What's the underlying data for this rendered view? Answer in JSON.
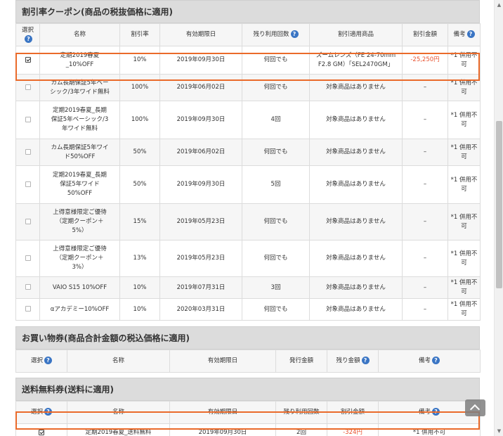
{
  "discount_section": {
    "title": "割引率クーポン(商品の税抜価格に適用)",
    "headers": {
      "select": "選択",
      "name": "名称",
      "rate": "割引率",
      "expiry": "有効期限日",
      "remaining": "残り利用回数",
      "product": "割引適用商品",
      "amount": "割引金額",
      "note": "備考"
    },
    "rows": [
      {
        "checked": true,
        "name": "定期2019春夏\n_10%OFF",
        "rate": "10%",
        "expiry": "2019年09月30日",
        "remaining": "何回でも",
        "product": "ズームレンズ（FE 24-70mm\nF2.8 GM）「SEL2470GM」",
        "amount": "-25,250円",
        "note": "*1 併用不可"
      },
      {
        "checked": false,
        "name": "カム長期保証5年ベー\nシック/3年ワイド無料",
        "rate": "100%",
        "expiry": "2019年06月02日",
        "remaining": "何回でも",
        "product": "対象商品はありません",
        "amount": "–",
        "note": "*1 併用不可"
      },
      {
        "checked": false,
        "name": "定期2019春夏_長期\n保証5年ベーシック/3\n年ワイド無料",
        "rate": "100%",
        "expiry": "2019年09月30日",
        "remaining": "4回",
        "product": "対象商品はありません",
        "amount": "–",
        "note": "*1 併用不可"
      },
      {
        "checked": false,
        "name": "カム長期保証5年ワイ\nド50%OFF",
        "rate": "50%",
        "expiry": "2019年06月02日",
        "remaining": "何回でも",
        "product": "対象商品はありません",
        "amount": "–",
        "note": "*1 併用不可"
      },
      {
        "checked": false,
        "name": "定期2019春夏_長期\n保証5年ワイド\n50%OFF",
        "rate": "50%",
        "expiry": "2019年09月30日",
        "remaining": "5回",
        "product": "対象商品はありません",
        "amount": "–",
        "note": "*1 併用不可"
      },
      {
        "checked": false,
        "name": "上得意様限定ご優待\n（定期クーポン＋\n5%）",
        "rate": "15%",
        "expiry": "2019年05月23日",
        "remaining": "何回でも",
        "product": "対象商品はありません",
        "amount": "–",
        "note": "*1 併用不可"
      },
      {
        "checked": false,
        "name": "上得意様限定ご優待\n（定期クーポン＋\n3%）",
        "rate": "13%",
        "expiry": "2019年05月23日",
        "remaining": "何回でも",
        "product": "対象商品はありません",
        "amount": "–",
        "note": "*1 併用不可"
      },
      {
        "checked": false,
        "name": "VAIO S15 10%OFF",
        "rate": "10%",
        "expiry": "2019年07月31日",
        "remaining": "3回",
        "product": "対象商品はありません",
        "amount": "–",
        "note": "*1 併用不可"
      },
      {
        "checked": false,
        "name": "αアカデミー10%OFF",
        "rate": "10%",
        "expiry": "2020年03月31日",
        "remaining": "何回でも",
        "product": "対象商品はありません",
        "amount": "–",
        "note": "*1 併用不可"
      }
    ]
  },
  "shopping_section": {
    "title": "お買い物券(商品合計金額の税込価格に適用)",
    "headers": {
      "select": "選択",
      "name": "名称",
      "expiry": "有効期限日",
      "issued": "発行金額",
      "remaining_amount": "残り金額",
      "note": "備考"
    }
  },
  "shipping_section": {
    "title": "送料無料券(送料に適用)",
    "headers": {
      "select": "選択",
      "name": "名称",
      "expiry": "有効期限日",
      "remaining": "残り利用回数",
      "amount": "割引金額",
      "note": "備考"
    },
    "rows": [
      {
        "checked": true,
        "name": "定期2019春夏_送料無料",
        "expiry": "2019年09月30日",
        "remaining": "2回",
        "amount": "-324円",
        "note": "*1 併用不可"
      }
    ]
  },
  "ui": {
    "help_glyph": "?",
    "scroll_up": "▲",
    "scroll_down": "▼"
  },
  "colors": {
    "highlight": "#ea6a2a",
    "help_badge": "#3a75c4",
    "negative_amount": "#e8522f"
  }
}
